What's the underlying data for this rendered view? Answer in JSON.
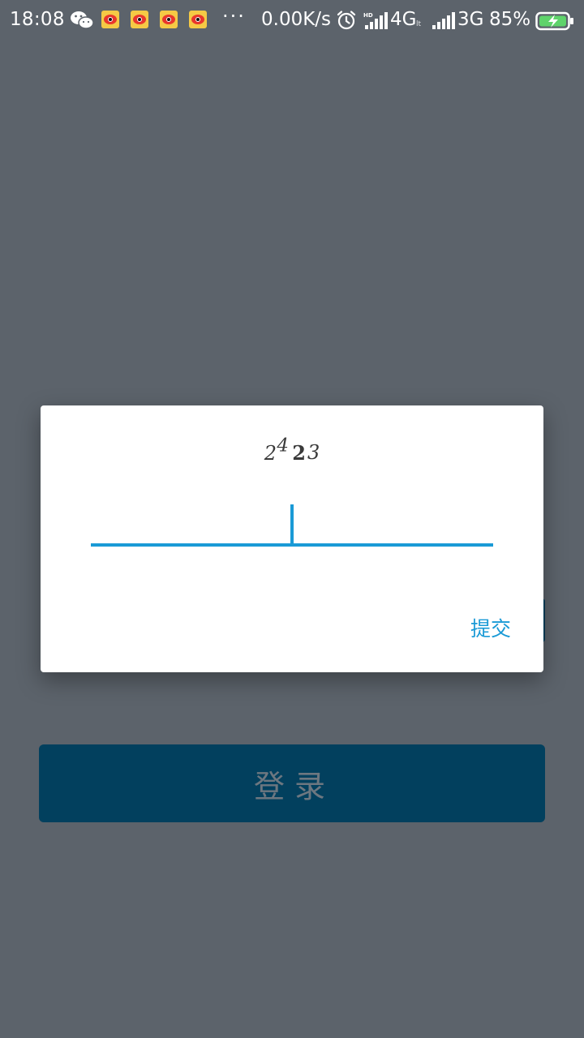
{
  "status_bar": {
    "time": "18:08",
    "more": "···",
    "network_speed": "0.00K/s",
    "network_4g": "4G",
    "network_lte_tag": "lt",
    "network_3g": "3G",
    "battery_percent": "85%",
    "icons": [
      "wechat-icon",
      "weibo-icon",
      "weibo-icon",
      "weibo-icon",
      "weibo-icon",
      "alarm-icon",
      "hd-signal-icon",
      "signal-icon",
      "battery-charging-icon"
    ]
  },
  "dialog": {
    "captcha_chars": [
      "2",
      "4",
      "2",
      "3"
    ],
    "input_value": "",
    "submit_label": "提交"
  },
  "login": {
    "button_label": "登录"
  },
  "colors": {
    "accent": "#1a9ad6",
    "login_bg": "#02405e",
    "overlay_bg": "#5c636b"
  }
}
